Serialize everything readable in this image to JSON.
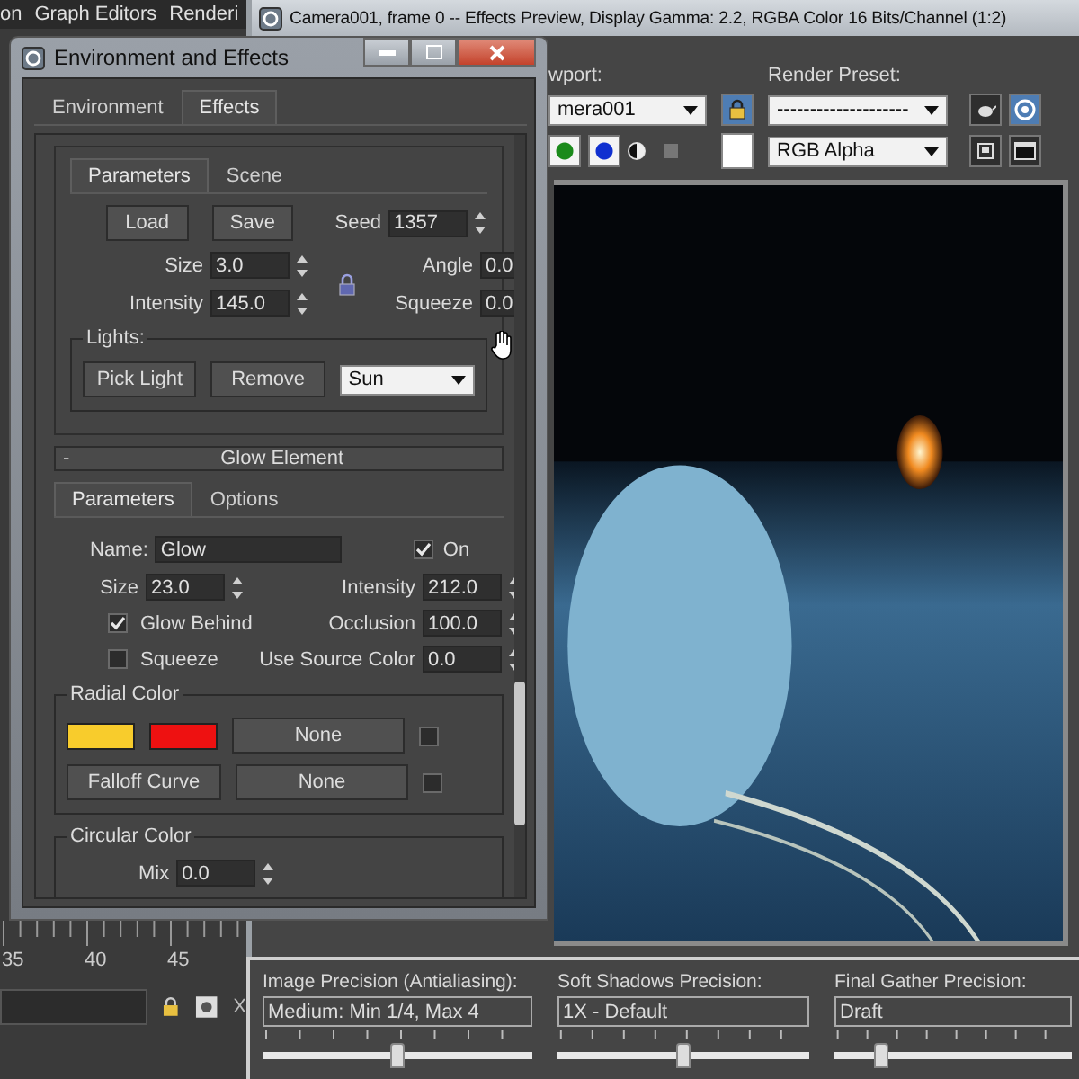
{
  "menu_bar": {
    "items": [
      "on",
      "Graph Editors",
      "Renderi"
    ]
  },
  "render_window": {
    "title": "Camera001, frame 0 -- Effects Preview, Display Gamma: 2.2, RGBA Color 16 Bits/Channel (1:2)",
    "viewport_label": "wport:",
    "viewport_value": "mera001",
    "preset_label": "Render Preset:",
    "preset_value": "--------------------",
    "channel_value": "RGB Alpha"
  },
  "timeline": {
    "ticks": [
      "35",
      "40",
      "45"
    ],
    "axis_label": "X"
  },
  "render_settings": [
    {
      "label": "Image Precision (Antialiasing):",
      "value": "Medium: Min 1/4, Max 4",
      "level": 0.5
    },
    {
      "label": "Soft Shadows Precision:",
      "value": "1X - Default",
      "level": 0.5
    },
    {
      "label": "Final Gather Precision:",
      "value": "Draft",
      "level": 0.2
    }
  ],
  "dialog": {
    "title": "Environment and Effects",
    "tabs": [
      {
        "label": "Environment",
        "selected": false
      },
      {
        "label": "Effects",
        "selected": true
      }
    ],
    "effects_panel": {
      "tabs": [
        {
          "label": "Parameters",
          "selected": true
        },
        {
          "label": "Scene",
          "selected": false
        }
      ],
      "buttons": [
        "Load",
        "Save"
      ],
      "seed": {
        "label": "Seed",
        "value": "1357"
      },
      "spinners": [
        {
          "label": "Size",
          "value": "3.0"
        },
        {
          "label": "Angle",
          "value": "0.0"
        },
        {
          "label": "Intensity",
          "value": "145.0"
        },
        {
          "label": "Squeeze",
          "value": "0.0"
        }
      ],
      "lights": {
        "title": "Lights:",
        "buttons": [
          "Pick Light",
          "Remove"
        ],
        "selection": "Sun"
      }
    },
    "glow_element": {
      "collapse": "-",
      "title": "Glow Element",
      "tabs": [
        {
          "label": "Parameters",
          "selected": true
        },
        {
          "label": "Options",
          "selected": false
        }
      ],
      "name": {
        "label": "Name:",
        "value": "Glow"
      },
      "on": {
        "label": "On",
        "checked": true
      },
      "rows": [
        {
          "left": {
            "kind": "spinner",
            "label": "Size",
            "value": "23.0"
          },
          "right": {
            "label": "Intensity",
            "value": "212.0"
          }
        },
        {
          "left": {
            "kind": "checkbox",
            "label": "Glow Behind",
            "checked": true
          },
          "right": {
            "label": "Occlusion",
            "value": "100.0"
          }
        },
        {
          "left": {
            "kind": "checkbox",
            "label": "Squeeze",
            "checked": false
          },
          "right": {
            "label": "Use Source Color",
            "value": "0.0"
          }
        }
      ],
      "radial_color": {
        "title": "Radial Color",
        "swatches": [
          {
            "color": "#f8cc2c"
          },
          {
            "color": "#ee1111"
          }
        ],
        "rows": [
          {
            "kind": "swatches",
            "map": "None",
            "checked": false
          },
          {
            "kind": "button",
            "label": "Falloff Curve",
            "map": "None",
            "checked": false
          }
        ]
      },
      "circular_color": {
        "title": "Circular Color",
        "mix": {
          "label": "Mix",
          "value": "0.0"
        }
      }
    }
  }
}
